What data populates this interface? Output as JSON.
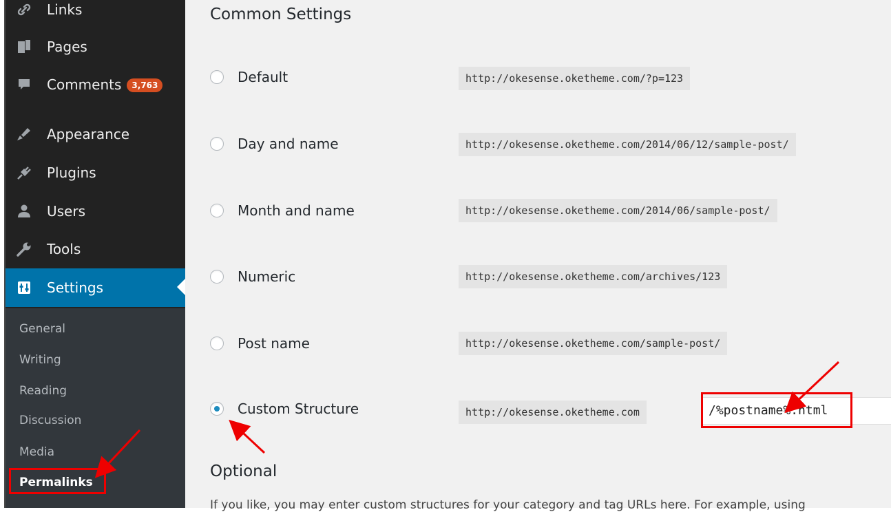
{
  "sidebar": {
    "menu": [
      {
        "label": "Links",
        "icon": "link-icon"
      },
      {
        "label": "Pages",
        "icon": "pages-icon"
      },
      {
        "label": "Comments",
        "icon": "comments-icon",
        "badge": "3,763"
      },
      {
        "label": "Appearance",
        "icon": "brush-icon"
      },
      {
        "label": "Plugins",
        "icon": "plugin-icon"
      },
      {
        "label": "Users",
        "icon": "users-icon"
      },
      {
        "label": "Tools",
        "icon": "wrench-icon"
      },
      {
        "label": "Settings",
        "icon": "settings-icon"
      }
    ],
    "submenu": [
      "General",
      "Writing",
      "Reading",
      "Discussion",
      "Media",
      "Permalinks"
    ]
  },
  "main": {
    "common_heading": "Common Settings",
    "options": [
      {
        "label": "Default",
        "url": "http://okesense.oketheme.com/?p=123",
        "checked": false
      },
      {
        "label": "Day and name",
        "url": "http://okesense.oketheme.com/2014/06/12/sample-post/",
        "checked": false
      },
      {
        "label": "Month and name",
        "url": "http://okesense.oketheme.com/2014/06/sample-post/",
        "checked": false
      },
      {
        "label": "Numeric",
        "url": "http://okesense.oketheme.com/archives/123",
        "checked": false
      },
      {
        "label": "Post name",
        "url": "http://okesense.oketheme.com/sample-post/",
        "checked": false
      },
      {
        "label": "Custom Structure",
        "url": "http://okesense.oketheme.com",
        "checked": true
      }
    ],
    "custom_value": "/%postname%.html",
    "optional_heading": "Optional",
    "optional_desc": "If you like, you may enter custom structures for your category and tag URLs here. For example, using"
  },
  "colors": {
    "sidebar_bg": "#222222",
    "active_bg": "#0073aa",
    "annotation": "#e00000",
    "badge": "#d54e21"
  }
}
